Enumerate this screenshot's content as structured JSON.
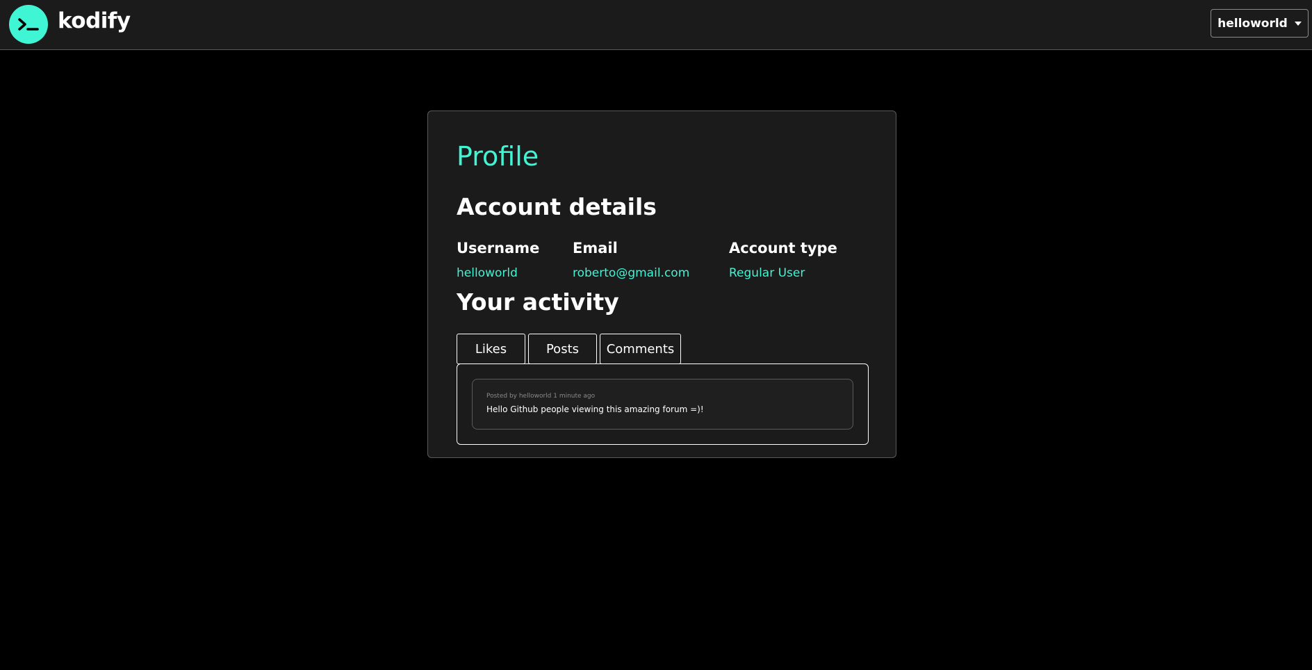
{
  "header": {
    "brand": "kodify",
    "logo_icon": "terminal-prompt-icon",
    "user_menu_label": "helloworld"
  },
  "colors": {
    "accent": "#3ff5d4",
    "background": "#000000",
    "surface": "#1b1b1b",
    "border": "#5a5a5a"
  },
  "profile": {
    "title": "Profile",
    "account_details_title": "Account details",
    "fields": [
      {
        "label": "Username",
        "value": "helloworld"
      },
      {
        "label": "Email",
        "value": "roberto@gmail.com"
      },
      {
        "label": "Account type",
        "value": "Regular User"
      }
    ],
    "activity_title": "Your activity",
    "tabs": [
      {
        "label": "Likes"
      },
      {
        "label": "Posts"
      },
      {
        "label": "Comments"
      }
    ],
    "items": [
      {
        "meta": "Posted by helloworld 1 minute ago",
        "text": "Hello Github people viewing this amazing forum =)!"
      }
    ]
  }
}
